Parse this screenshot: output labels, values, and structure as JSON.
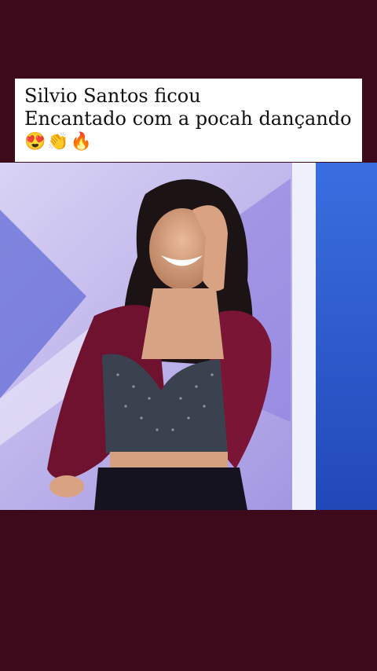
{
  "caption": {
    "line1": "Silvio Santos ficou",
    "line2": "Encantado com a pocah dançando",
    "emojis": "😍👏🔥"
  },
  "icons": [
    "heart-eyes-emoji-icon",
    "clapping-hands-emoji-icon",
    "fire-emoji-icon"
  ],
  "colors": {
    "background": "#3d0a1c",
    "caption_bg": "#ffffff",
    "caption_text": "#111111",
    "studio_blue": "#2f5fd0",
    "studio_lilac": "#b9b3e8"
  }
}
